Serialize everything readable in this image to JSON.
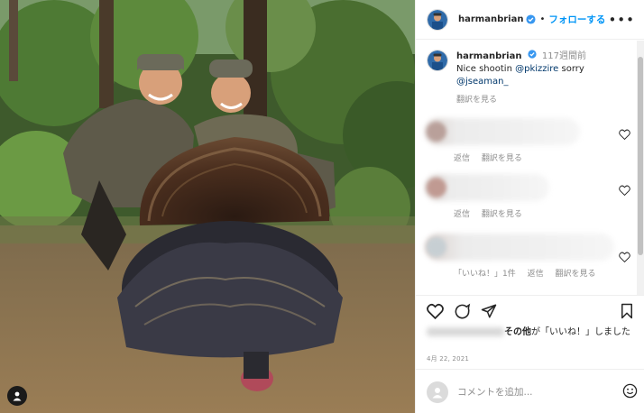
{
  "post": {
    "username": "harmanbrian",
    "follow_label": "フォローする",
    "dot": "•",
    "more_label": "•••",
    "caption": {
      "username": "harmanbrian",
      "time": "117週間前",
      "text_prefix": "Nice shootin ",
      "mention1": "@pkizzire",
      "text_middle": " sorry ",
      "mention2": "@jseaman_",
      "translate_label": "翻訳を見る"
    },
    "comments": [
      {
        "reply_label": "返信",
        "translate_label": "翻訳を見る"
      },
      {
        "reply_label": "返信",
        "translate_label": "翻訳を見る"
      },
      {
        "likes_label": "「いいね！」1件",
        "reply_label": "返信",
        "translate_label": "翻訳を見る"
      }
    ],
    "likes": {
      "suffix_bold": "その他",
      "suffix_text": "が「いいね！」しました"
    },
    "date": "4月 22, 2021",
    "comment_input": {
      "placeholder": "コメントを追加..."
    }
  },
  "icons": {
    "verified": "verified-badge-icon",
    "heart": "heart-icon",
    "comment": "comment-icon",
    "share": "share-icon",
    "bookmark": "bookmark-icon",
    "emoji": "emoji-icon",
    "user_tag": "user-tag-icon"
  },
  "colors": {
    "link": "#0095f6",
    "mention": "#00376b",
    "muted": "#8e8e8e",
    "verified": "#3897f0"
  }
}
